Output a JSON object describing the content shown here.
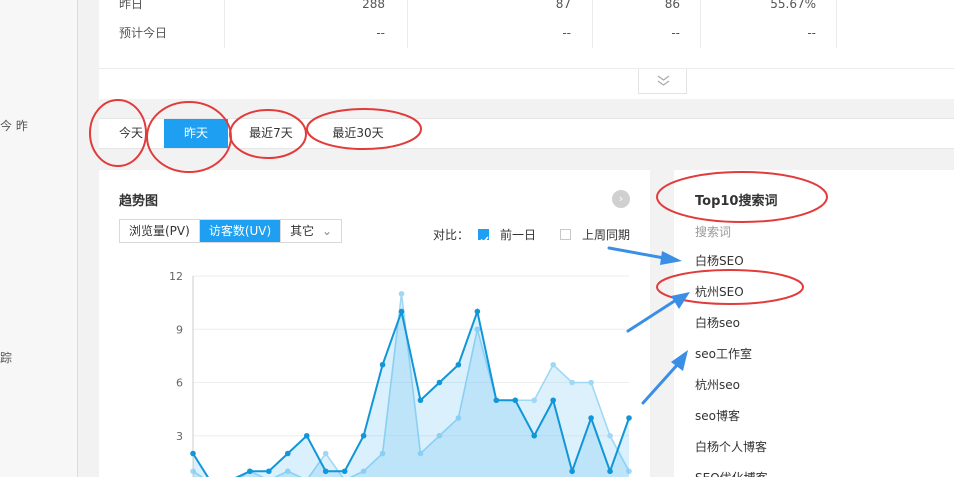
{
  "sidebar": {
    "label_top": "今  昨",
    "label_mid": "踪"
  },
  "stats": {
    "rows": [
      {
        "label": "昨日",
        "cells": [
          "288",
          "87",
          "86",
          "55.67%"
        ]
      },
      {
        "label": "预计今日",
        "cells": [
          "--",
          "--",
          "--",
          "--"
        ]
      }
    ]
  },
  "tabs": [
    {
      "label": "今天",
      "active": false
    },
    {
      "label": "昨天",
      "active": true
    },
    {
      "label": "最近7天",
      "active": false
    },
    {
      "label": "最近30天",
      "active": false
    }
  ],
  "trend": {
    "title": "趋势图",
    "metrics": [
      "浏览量(PV)",
      "访客数(UV)",
      "其它"
    ],
    "active_metric": "访客数(UV)",
    "compare_label": "对比：",
    "compare_prev_day": "前一日",
    "compare_last_week": "上周同期",
    "prev_day_checked": true,
    "last_week_checked": false
  },
  "chart_data": {
    "type": "area",
    "ylim": [
      0,
      12
    ],
    "yticks": [
      "3",
      "6",
      "9",
      "12"
    ],
    "x": [
      0,
      1,
      2,
      3,
      4,
      5,
      6,
      7,
      8,
      9,
      10,
      11,
      12,
      13,
      14,
      15,
      16,
      17,
      18,
      19,
      20,
      21,
      22,
      23
    ],
    "series": [
      {
        "values": [
          2,
          0.3,
          0.5,
          1,
          1,
          2,
          3,
          1,
          1,
          3,
          7,
          10,
          5,
          6,
          7,
          10,
          5,
          5,
          3,
          5,
          1,
          4,
          1,
          4
        ]
      },
      {
        "values": [
          1,
          0.3,
          0.3,
          1,
          0.5,
          1,
          0.5,
          2,
          0.5,
          1,
          2,
          11,
          2,
          3,
          4,
          9,
          5,
          5,
          5,
          7,
          6,
          6,
          3,
          1
        ]
      }
    ],
    "colors": [
      "#1196d8",
      "#9fd8f5"
    ]
  },
  "top10": {
    "title": "Top10搜索词",
    "header": "搜索词",
    "keywords": [
      "白杨SEO",
      "杭州SEO",
      "白杨seo",
      "seo工作室",
      "杭州seo",
      "seo博客",
      "白杨个人博客",
      "SEO优化博客"
    ]
  },
  "annotation_color": "#e23b3b",
  "arrow_color": "#3a8ee6"
}
